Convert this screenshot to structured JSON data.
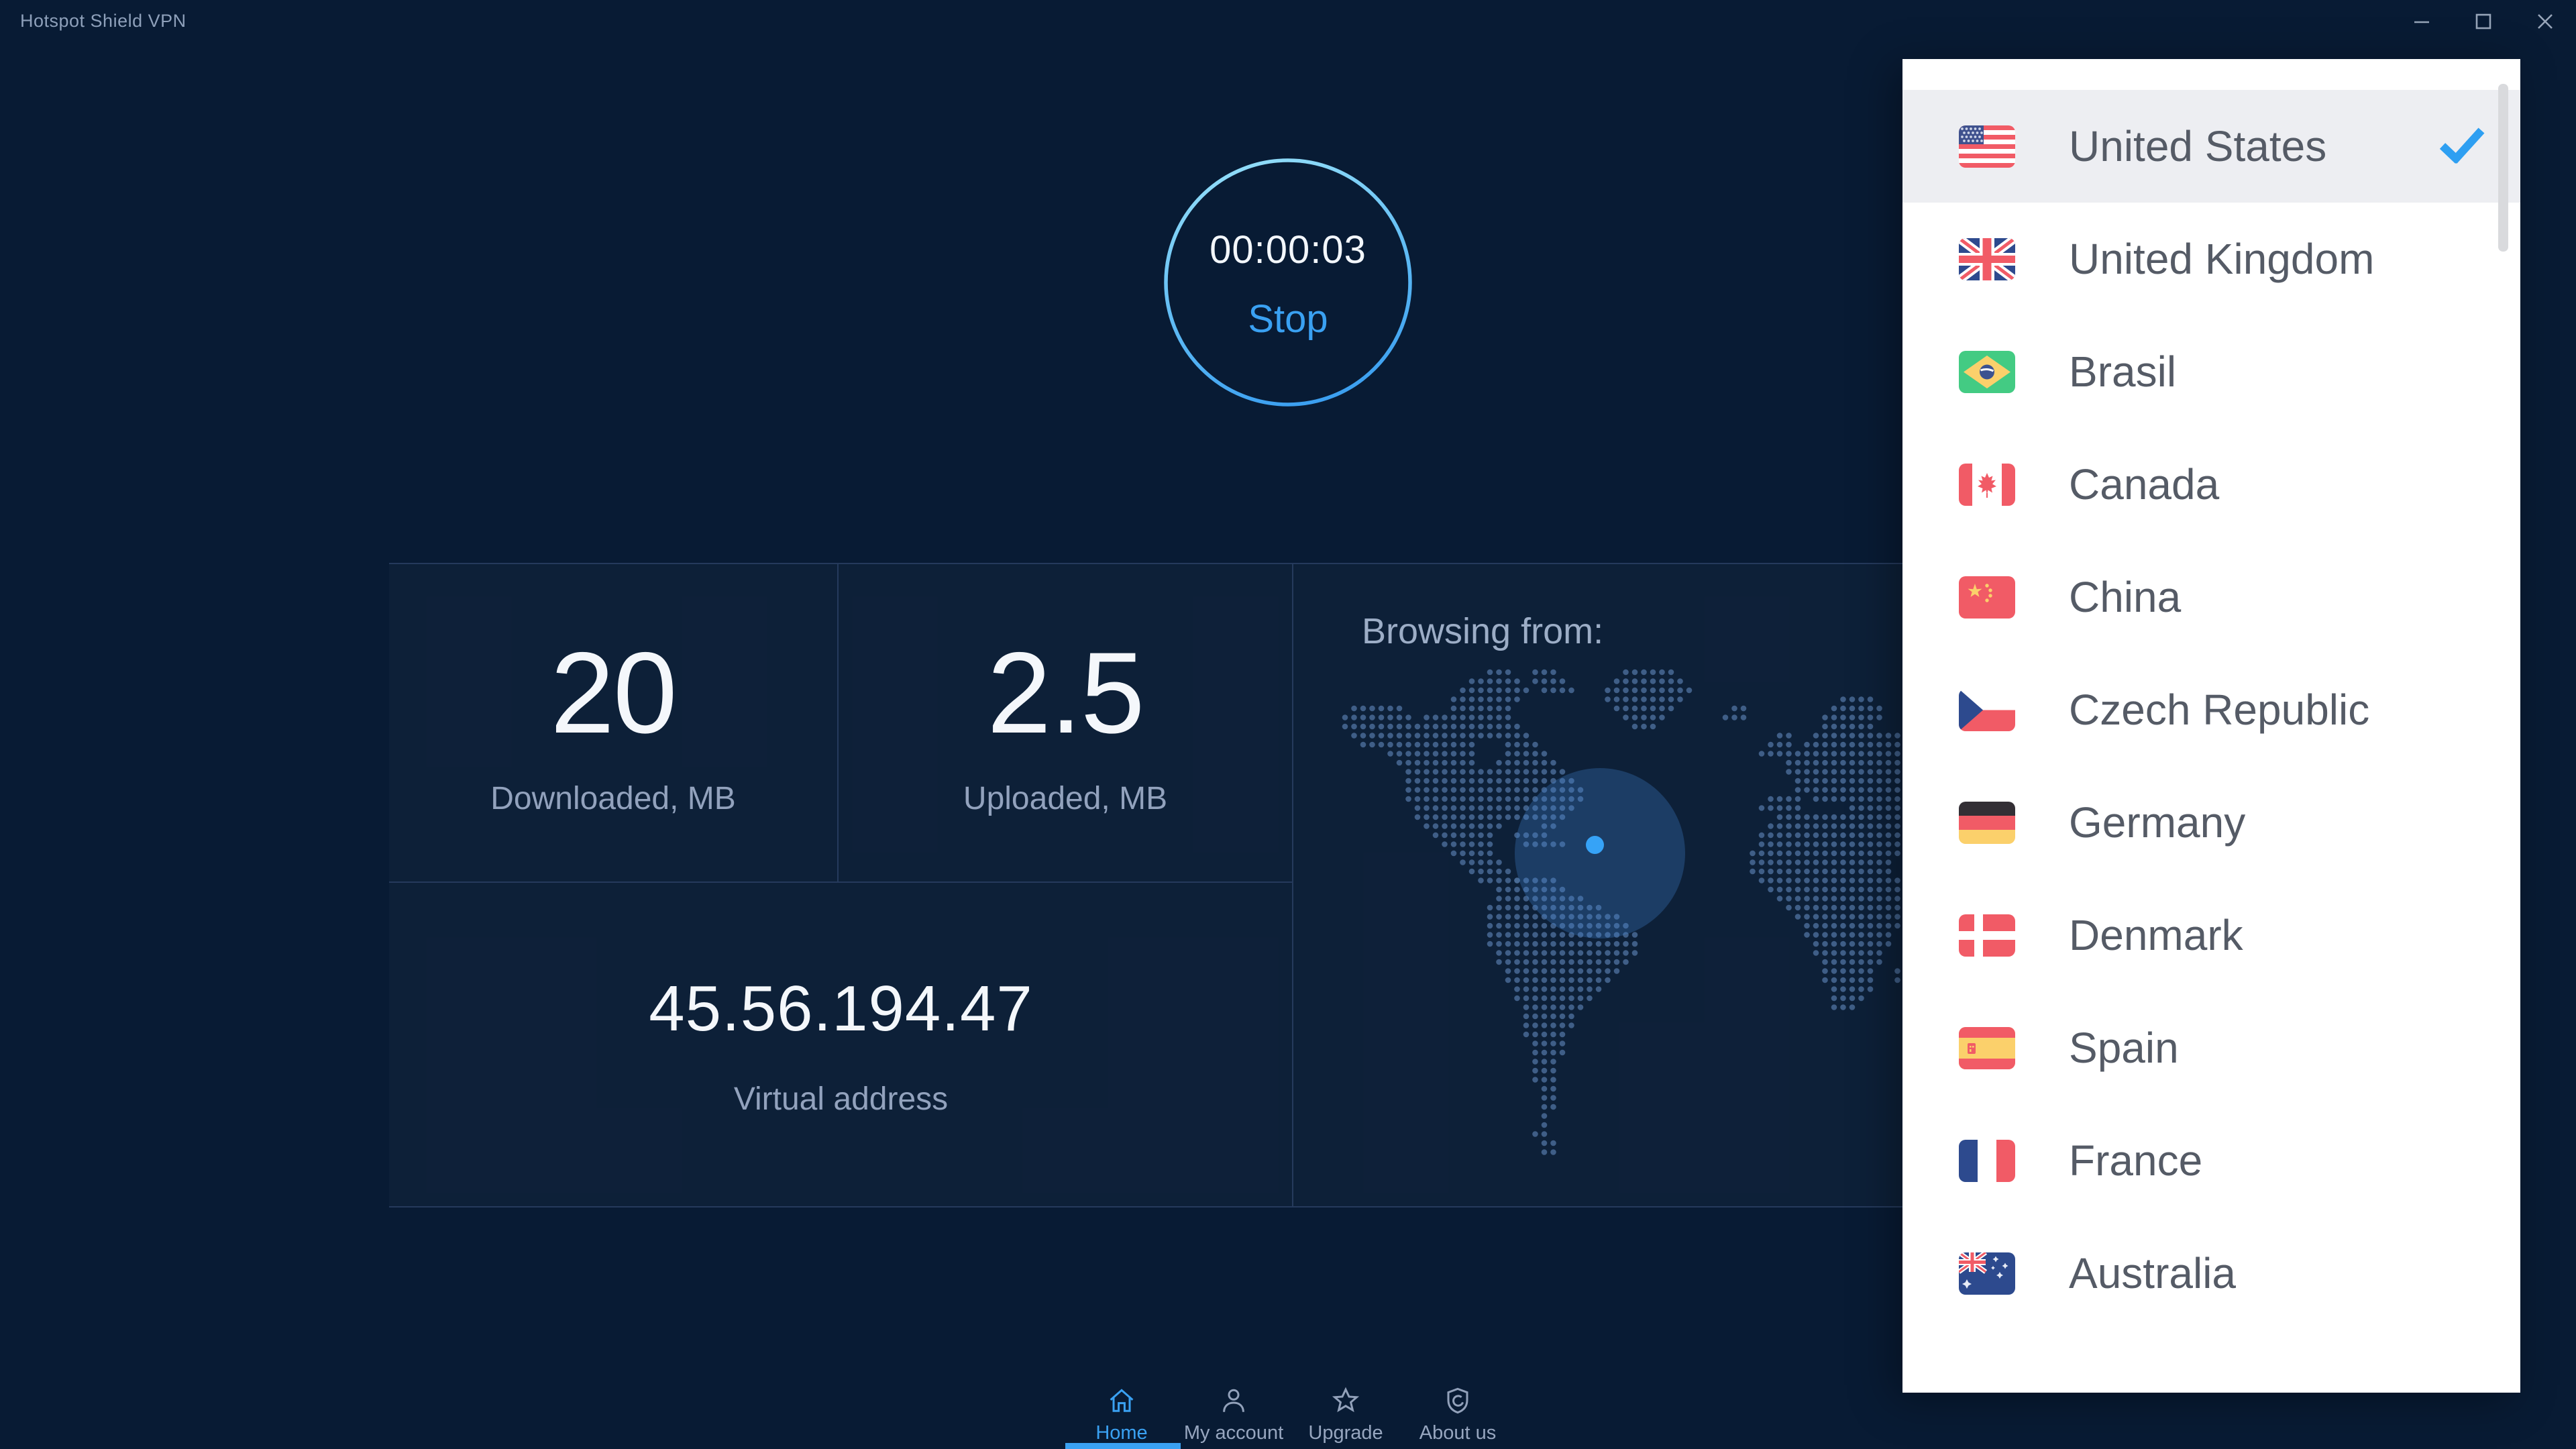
{
  "window": {
    "title": "Hotspot Shield VPN",
    "controls": [
      {
        "name": "minimize",
        "icon": "minimize-icon"
      },
      {
        "name": "maximize",
        "icon": "maximize-icon"
      },
      {
        "name": "close",
        "icon": "close-icon"
      }
    ]
  },
  "timer": {
    "elapsed": "00:00:03",
    "button_label": "Stop"
  },
  "stats": {
    "download": {
      "value": "20",
      "label": "Downloaded, MB"
    },
    "upload": {
      "value": "2.5",
      "label": "Uploaded, MB"
    }
  },
  "virtual_address": {
    "value": "45.56.194.47",
    "label": "Virtual address"
  },
  "map": {
    "title": "Browsing from:"
  },
  "server_list": {
    "selected": "United States",
    "items": [
      {
        "name": "United States",
        "flag": "us",
        "selected": true
      },
      {
        "name": "United Kingdom",
        "flag": "gb",
        "selected": false
      },
      {
        "name": "Brasil",
        "flag": "br",
        "selected": false
      },
      {
        "name": "Canada",
        "flag": "ca",
        "selected": false
      },
      {
        "name": "China",
        "flag": "cn",
        "selected": false
      },
      {
        "name": "Czech Republic",
        "flag": "cz",
        "selected": false
      },
      {
        "name": "Germany",
        "flag": "de",
        "selected": false
      },
      {
        "name": "Denmark",
        "flag": "dk",
        "selected": false
      },
      {
        "name": "Spain",
        "flag": "es",
        "selected": false
      },
      {
        "name": "France",
        "flag": "fr",
        "selected": false
      },
      {
        "name": "Australia",
        "flag": "au",
        "selected": false
      }
    ]
  },
  "nav": {
    "items": [
      {
        "label": "Home",
        "icon": "home-icon",
        "active": true
      },
      {
        "label": "My account",
        "icon": "user-icon",
        "active": false
      },
      {
        "label": "Upgrade",
        "icon": "star-icon",
        "active": false
      },
      {
        "label": "About us",
        "icon": "shield-icon",
        "active": false
      }
    ]
  },
  "colors": {
    "background": "#081b34",
    "accent": "#3aa1f2",
    "check": "#2e9ff2",
    "ring_top": "#90dcf8",
    "ring_bottom": "#3a9ef0",
    "divider": "#253a5c",
    "panel": "#ffffff",
    "selected_row": "#edeef2",
    "country_text": "#555b66",
    "muted_text": "#92a2bd",
    "map_dot": "#4a6d99",
    "flag_red": "#f15b66",
    "flag_blue": "#2e4a8e",
    "flag_yellow": "#fbd06b",
    "flag_green": "#43cb83"
  }
}
